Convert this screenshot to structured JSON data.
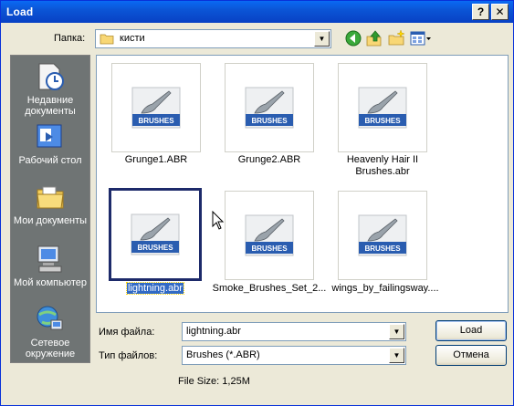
{
  "window": {
    "title": "Load",
    "help_glyph": "?",
    "close_glyph": "✕"
  },
  "look_in": {
    "label": "Папка:",
    "value": "кисти"
  },
  "places": [
    {
      "label": "Недавние документы",
      "icon": "recent-documents-icon"
    },
    {
      "label": "Рабочий стол",
      "icon": "desktop-icon"
    },
    {
      "label": "Мои документы",
      "icon": "my-documents-icon"
    },
    {
      "label": "Мой компьютер",
      "icon": "my-computer-icon"
    },
    {
      "label": "Сетевое окружение",
      "icon": "network-places-icon"
    }
  ],
  "files": [
    {
      "name": "Grunge1.ABR",
      "badge": "BRUSHES"
    },
    {
      "name": "Grunge2.ABR",
      "badge": "BRUSHES"
    },
    {
      "name": "Heavenly Hair II Brushes.abr",
      "badge": "BRUSHES"
    },
    {
      "name": "lightning.abr",
      "badge": "BRUSHES",
      "selected": true
    },
    {
      "name": "Smoke_Brushes_Set_2...",
      "badge": "BRUSHES"
    },
    {
      "name": "wings_by_failingsway....",
      "badge": "BRUSHES"
    }
  ],
  "file_name": {
    "label": "Имя файла:",
    "value": "lightning.abr"
  },
  "file_type": {
    "label": "Тип файлов:",
    "value": "Brushes (*.ABR)"
  },
  "buttons": {
    "load": "Load",
    "cancel": "Отмена"
  },
  "file_size": "File Size: 1,25M",
  "colors": {
    "titlebar": "#0a5ae0",
    "places_bg": "#6f7474",
    "selection": "#316ac5",
    "badge": "#2a5db0"
  }
}
